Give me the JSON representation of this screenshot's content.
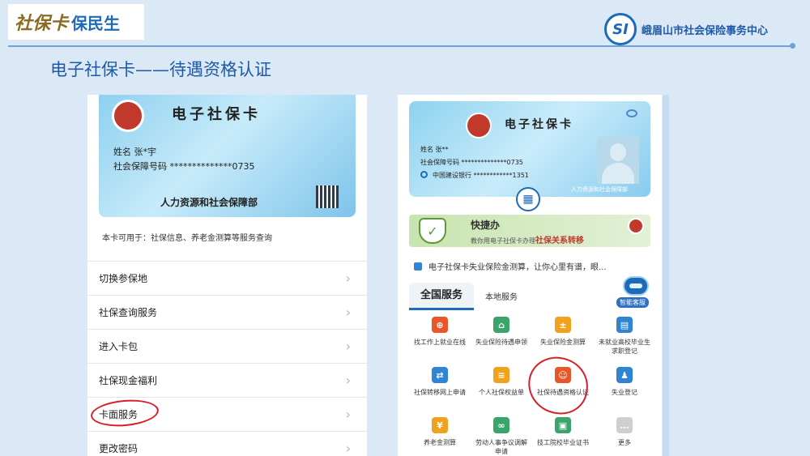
{
  "header": {
    "logo_brand": "社保卡",
    "logo_brand2": "保民生",
    "si_badge": "SI",
    "org_name": "峨眉山市社会保险事务中心"
  },
  "page_title": "电子社保卡——待遇资格认证",
  "left_card": {
    "title": "电子社保卡",
    "name_line": "姓名 张*宇",
    "number_line": "社会保障号码 **************0735",
    "issuer": "人力资源和社会保障部"
  },
  "left_usage_note": "本卡可用于：社保信息、养老金测算等服务查询",
  "left_menu": [
    {
      "label": "切换参保地"
    },
    {
      "label": "社保查询服务"
    },
    {
      "label": "进入卡包"
    },
    {
      "label": "社保现金福利"
    },
    {
      "label": "卡面服务"
    },
    {
      "label": "更改密码"
    }
  ],
  "right_card": {
    "title": "电子社保卡",
    "name_line": "姓名  张**",
    "number_line": "社会保障号码  **************0735",
    "bank_line": "中国建设银行    ************1351",
    "issuer": "人力资源和社会保障部"
  },
  "quick_banner": {
    "title": "快捷办",
    "subtitle_prefix": "教你用电子社保卡办理",
    "subtitle_highlight": "社保关系转移"
  },
  "ticker": "电子社保卡失业保险金测算，让你心里有谱，眼...",
  "tabs": {
    "national": "全国服务",
    "local": "本地服务"
  },
  "assistant_label": "智能客服",
  "services": [
    {
      "label": "找工作上就业在线",
      "icon": "briefcase-icon",
      "color": "#e8562a"
    },
    {
      "label": "失业保险待遇申领",
      "icon": "house-icon",
      "color": "#3aa56b"
    },
    {
      "label": "失业保险金测算",
      "icon": "calculator-icon",
      "color": "#f0a21c"
    },
    {
      "label": "未就业高校毕业生求职登记",
      "icon": "id-card-icon",
      "color": "#2f85d1"
    },
    {
      "label": "社保转移网上申请",
      "icon": "transfer-icon",
      "color": "#2f85d1"
    },
    {
      "label": "个人社保权益单",
      "icon": "document-icon",
      "color": "#f0a21c"
    },
    {
      "label": "社保待遇资格认证",
      "icon": "face-verify-icon",
      "color": "#e8562a"
    },
    {
      "label": "失业登记",
      "icon": "person-icon",
      "color": "#2f85d1"
    },
    {
      "label": "养老金测算",
      "icon": "coin-icon",
      "color": "#f0a21c"
    },
    {
      "label": "劳动人事争议调解申请",
      "icon": "handshake-icon",
      "color": "#3aa56b"
    },
    {
      "label": "技工院校毕业证书",
      "icon": "certificate-icon",
      "color": "#3aa56b"
    },
    {
      "label": "更多",
      "icon": "more-icon",
      "color": "#cfcfcf"
    }
  ]
}
